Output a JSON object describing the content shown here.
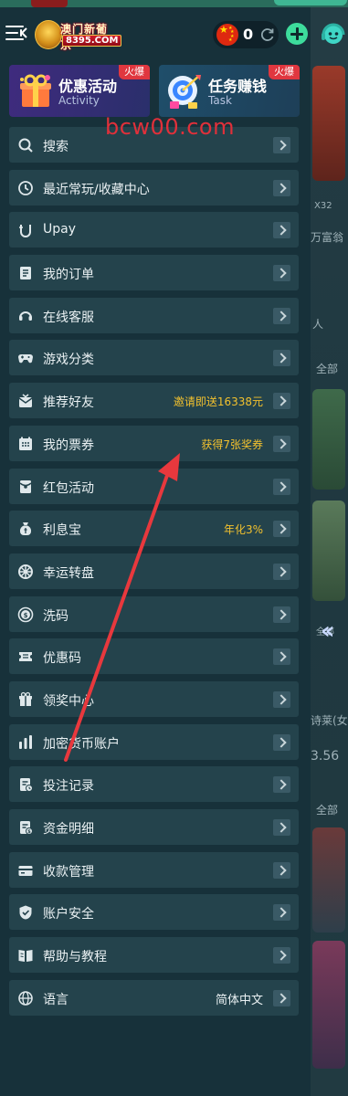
{
  "header": {
    "logo_name": "澳门新葡京",
    "logo_domain": "8395.COM",
    "balance": "0"
  },
  "promos": [
    {
      "title": "优惠活动",
      "subtitle": "Activity",
      "badge": "火爆"
    },
    {
      "title": "任务赚钱",
      "subtitle": "Task",
      "badge": "火爆"
    }
  ],
  "watermark": "bcw00.com",
  "menu": [
    {
      "label": "搜索",
      "icon": "search-icon",
      "extra": ""
    },
    {
      "label": "最近常玩/收藏中心",
      "icon": "clock-icon",
      "extra": ""
    },
    {
      "label": "Upay",
      "icon": "upay-icon",
      "extra": ""
    },
    {
      "label": "我的订单",
      "icon": "order-icon",
      "extra": ""
    },
    {
      "label": "在线客服",
      "icon": "headset-icon",
      "extra": ""
    },
    {
      "label": "游戏分类",
      "icon": "gamepad-icon",
      "extra": ""
    },
    {
      "label": "推荐好友",
      "icon": "invite-icon",
      "extra": "邀请即送16338元"
    },
    {
      "label": "我的票券",
      "icon": "ticket-icon",
      "extra": "获得7张奖券"
    },
    {
      "label": "红包活动",
      "icon": "red-envelope-icon",
      "extra": ""
    },
    {
      "label": "利息宝",
      "icon": "money-bag-icon",
      "extra": "年化3%"
    },
    {
      "label": "幸运转盘",
      "icon": "wheel-icon",
      "extra": ""
    },
    {
      "label": "洗码",
      "icon": "coin-icon",
      "extra": ""
    },
    {
      "label": "优惠码",
      "icon": "coupon-icon",
      "extra": ""
    },
    {
      "label": "领奖中心",
      "icon": "gift-icon",
      "extra": ""
    },
    {
      "label": "加密货币账户",
      "icon": "crypto-icon",
      "extra": ""
    },
    {
      "label": "投注记录",
      "icon": "bet-record-icon",
      "extra": ""
    },
    {
      "label": "资金明细",
      "icon": "funds-icon",
      "extra": ""
    },
    {
      "label": "收款管理",
      "icon": "card-icon",
      "extra": ""
    },
    {
      "label": "账户安全",
      "icon": "shield-icon",
      "extra": ""
    },
    {
      "label": "帮助与教程",
      "icon": "book-icon",
      "extra": ""
    },
    {
      "label": "语言",
      "icon": "globe-icon",
      "extra": "简体中文"
    }
  ],
  "background_labels": {
    "multiplier": "X32",
    "rich": "万富翁",
    "person": "人",
    "all1": "全部",
    "all2": "全部",
    "all3": "全部",
    "player": "诗莱(女)",
    "score": "3.56"
  },
  "colors": {
    "drawer_bg": "#17313a",
    "row_bg": "#24434c",
    "highlight": "#f2c12e",
    "hot_badge": "#e0373f",
    "annotation_arrow": "#e8383d"
  }
}
